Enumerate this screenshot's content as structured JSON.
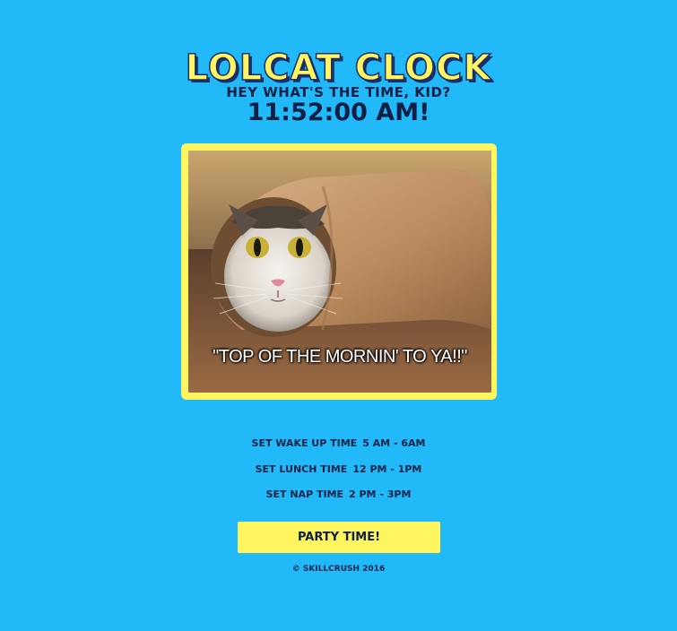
{
  "app": {
    "title": "LOLCAT CLOCK"
  },
  "clock": {
    "question": "HEY WHAT'S THE TIME, KID?",
    "time": "11:52:00 AM!"
  },
  "photo": {
    "caption": "\"TOP OF THE MORNIN' TO YA!!\""
  },
  "settings": [
    {
      "label": "SET WAKE UP TIME",
      "value": "5 AM - 6AM"
    },
    {
      "label": "SET LUNCH TIME",
      "value": "12 PM - 1PM"
    },
    {
      "label": "SET NAP TIME",
      "value": "2 PM - 3PM"
    }
  ],
  "party_button": {
    "label": "PARTY TIME!"
  },
  "footer": {
    "text": "© SKILLCRUSH 2016"
  },
  "colors": {
    "background": "#22b9f8",
    "accent_yellow": "#fff55f",
    "text_navy": "#12234a"
  }
}
